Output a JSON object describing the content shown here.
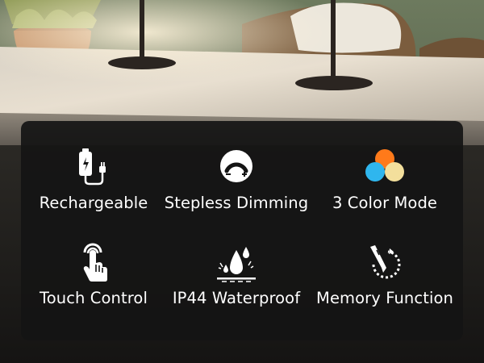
{
  "features": [
    {
      "label": "Rechargeable",
      "icon": "battery-cable-icon"
    },
    {
      "label": "Stepless Dimming",
      "icon": "dimmer-dial-icon"
    },
    {
      "label": "3 Color Mode",
      "icon": "three-color-circles-icon"
    },
    {
      "label": "Touch Control",
      "icon": "touch-hand-icon"
    },
    {
      "label": "IP44 Waterproof",
      "icon": "water-drops-icon"
    },
    {
      "label": "Memory Function",
      "icon": "memory-pen-icon"
    }
  ],
  "colors": {
    "panel": "#141414",
    "text": "#ffffff",
    "color_mode_orange": "#ff7a1a",
    "color_mode_blue": "#2fb6ee",
    "color_mode_cream": "#f3df9c"
  }
}
